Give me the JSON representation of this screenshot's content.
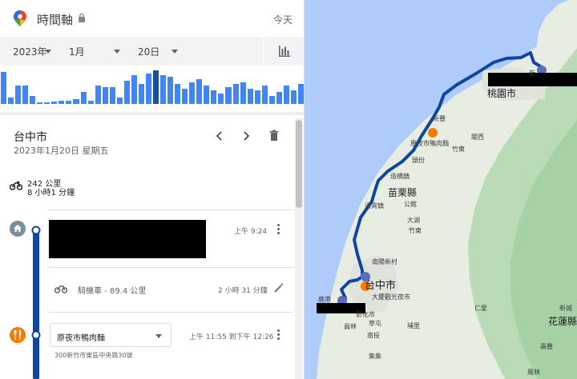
{
  "header": {
    "title": "時間軸",
    "today": "今天"
  },
  "date_selector": {
    "year": "2023年",
    "month": "1月",
    "day": "20日"
  },
  "histogram": {
    "values": [
      0.95,
      0.2,
      0.55,
      0.55,
      0.25,
      0.05,
      0.05,
      0.07,
      0.1,
      0.1,
      0.15,
      0.35,
      0.1,
      0.55,
      0.5,
      0.5,
      0.2,
      0.7,
      0.85,
      0.6,
      0.9,
      1.0,
      0.85,
      0.8,
      0.6,
      0.45,
      0.65,
      0.75,
      0.55,
      0.4,
      0.3,
      0.5,
      0.6,
      0.65,
      0.45,
      0.4,
      0.55,
      0.25,
      0.35,
      0.55,
      0.4,
      0.6
    ],
    "selected_index": 21,
    "colors": {
      "bar": "#4285f4",
      "selected": "#174ea6"
    }
  },
  "day_summary": {
    "city": "台中市",
    "date": "2023年1月20日 星期五",
    "distance": "242 公里",
    "duration": "8 小時1 分鐘"
  },
  "timeline": {
    "first_stop": {
      "time": "上午 9:24"
    },
    "activity": {
      "label": "騎機車 - 89.4 公里",
      "duration": "2 小時 31 分鐘"
    },
    "stop": {
      "name": "原夜市鴨肉麵",
      "time": "上午 11:55 到下午 12:26",
      "address": "300新竹市東區中央路30號"
    }
  },
  "map": {
    "route_color": "#0d47a1",
    "land_color": "#e7ede0",
    "sea_color": "#aecbfa",
    "mountain_color": "#b5d8b5",
    "labels": {
      "taoyuan": "桃園市",
      "xin": "新",
      "xinfeng": "新豐",
      "hsinchu_shop": "原夜市鴨肉麵",
      "guanxi": "關西",
      "zhubei": "竹東",
      "qionglin": "頭份",
      "zhunan": "竹南",
      "zaoqiao": "造橋鎮",
      "miaoli_county": "苗栗縣",
      "tongxiao": "通霄鎮",
      "gongguan": "公館",
      "daxi": "大湖",
      "taichung": "台中市",
      "nanyangxincun": "南陽新村",
      "taichung_poi": "大慶觀光夜市",
      "lugang": "鹿港",
      "changhua": "彰化市",
      "yuanlin": "員林",
      "caotun": "草屯",
      "puli": "埔里",
      "nantou": "南投",
      "renai": "仁愛",
      "jiji": "集集",
      "xincheng": "新城",
      "hualien": "花蓮縣",
      "shoufeng": "壽豐",
      "fenglin": "鳳林",
      "zhudong": "竹東"
    }
  }
}
